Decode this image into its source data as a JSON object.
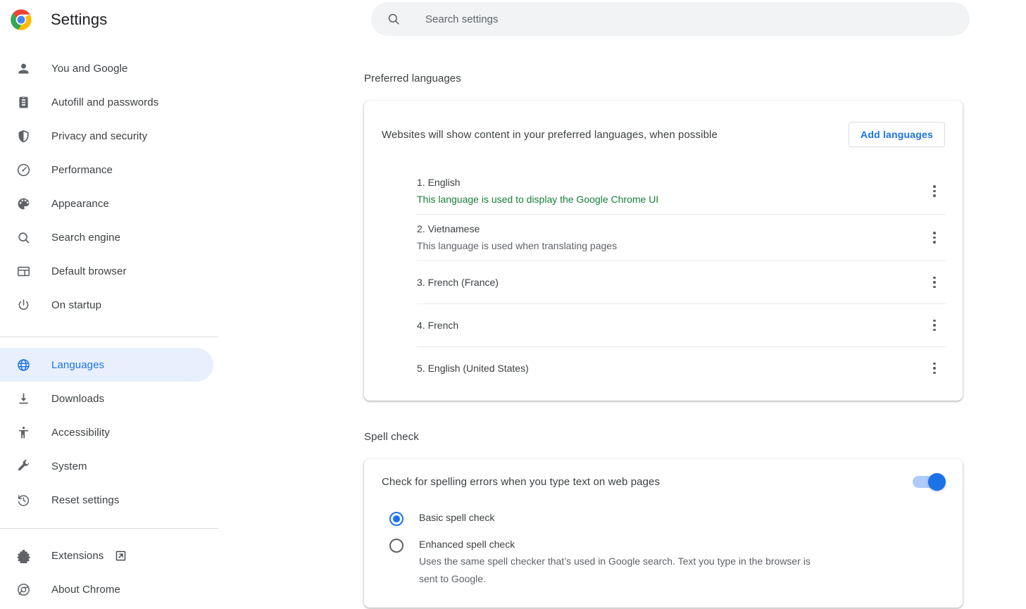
{
  "brand": {
    "title": "Settings",
    "logo_icon": "chrome-logo-icon"
  },
  "search": {
    "placeholder": "Search settings",
    "value": "",
    "icon": "search-icon"
  },
  "sidebar": {
    "primary_items": [
      {
        "label": "You and Google",
        "icon": "person-icon"
      },
      {
        "label": "Autofill and passwords",
        "icon": "clipboard-icon"
      },
      {
        "label": "Privacy and security",
        "icon": "shield-icon"
      },
      {
        "label": "Performance",
        "icon": "speedometer-icon"
      },
      {
        "label": "Appearance",
        "icon": "palette-icon"
      },
      {
        "label": "Search engine",
        "icon": "magnifier-icon"
      },
      {
        "label": "Default browser",
        "icon": "browser-window-icon"
      },
      {
        "label": "On startup",
        "icon": "power-icon"
      }
    ],
    "secondary_items": [
      {
        "label": "Languages",
        "icon": "globe-icon",
        "active": true
      },
      {
        "label": "Downloads",
        "icon": "download-icon",
        "active": false
      },
      {
        "label": "Accessibility",
        "icon": "accessibility-icon",
        "active": false
      },
      {
        "label": "System",
        "icon": "wrench-icon",
        "active": false
      },
      {
        "label": "Reset settings",
        "icon": "history-restore-icon",
        "active": false
      }
    ],
    "footer_items": [
      {
        "label": "Extensions",
        "icon": "puzzle-icon",
        "external": true,
        "external_icon": "external-link-icon"
      },
      {
        "label": "About Chrome",
        "icon": "chrome-outline-icon",
        "external": false
      }
    ]
  },
  "main": {
    "preferred_languages": {
      "section_title": "Preferred languages",
      "description": "Websites will show content in your preferred languages, when possible",
      "add_button": "Add languages",
      "languages": [
        {
          "name": "1. English",
          "desc": "This language is used to display the Google Chrome UI",
          "desc_style": "ui",
          "menu_icon": "more-vertical-icon"
        },
        {
          "name": "2. Vietnamese",
          "desc": "This language is used when translating pages",
          "desc_style": "normal",
          "menu_icon": "more-vertical-icon"
        },
        {
          "name": "3. French (France)",
          "desc": "",
          "desc_style": "normal",
          "menu_icon": "more-vertical-icon"
        },
        {
          "name": "4. French",
          "desc": "",
          "desc_style": "normal",
          "menu_icon": "more-vertical-icon"
        },
        {
          "name": "5. English (United States)",
          "desc": "",
          "desc_style": "normal",
          "menu_icon": "more-vertical-icon"
        }
      ]
    },
    "spell_check": {
      "section_title": "Spell check",
      "toggle_label": "Check for spelling errors when you type text on web pages",
      "toggle_state": "on",
      "options": [
        {
          "label": "Basic spell check",
          "sub": "",
          "selected": true
        },
        {
          "label": "Enhanced spell check",
          "sub": "Uses the same spell checker that’s used in Google search. Text you type in the browser is sent to Google.",
          "selected": false
        }
      ]
    }
  },
  "colors": {
    "accent": "#1a73e8",
    "active_pill_bg": "#e8f0fe",
    "green_status": "#188038",
    "text_primary": "#3c4043",
    "text_secondary": "#5f6368"
  }
}
